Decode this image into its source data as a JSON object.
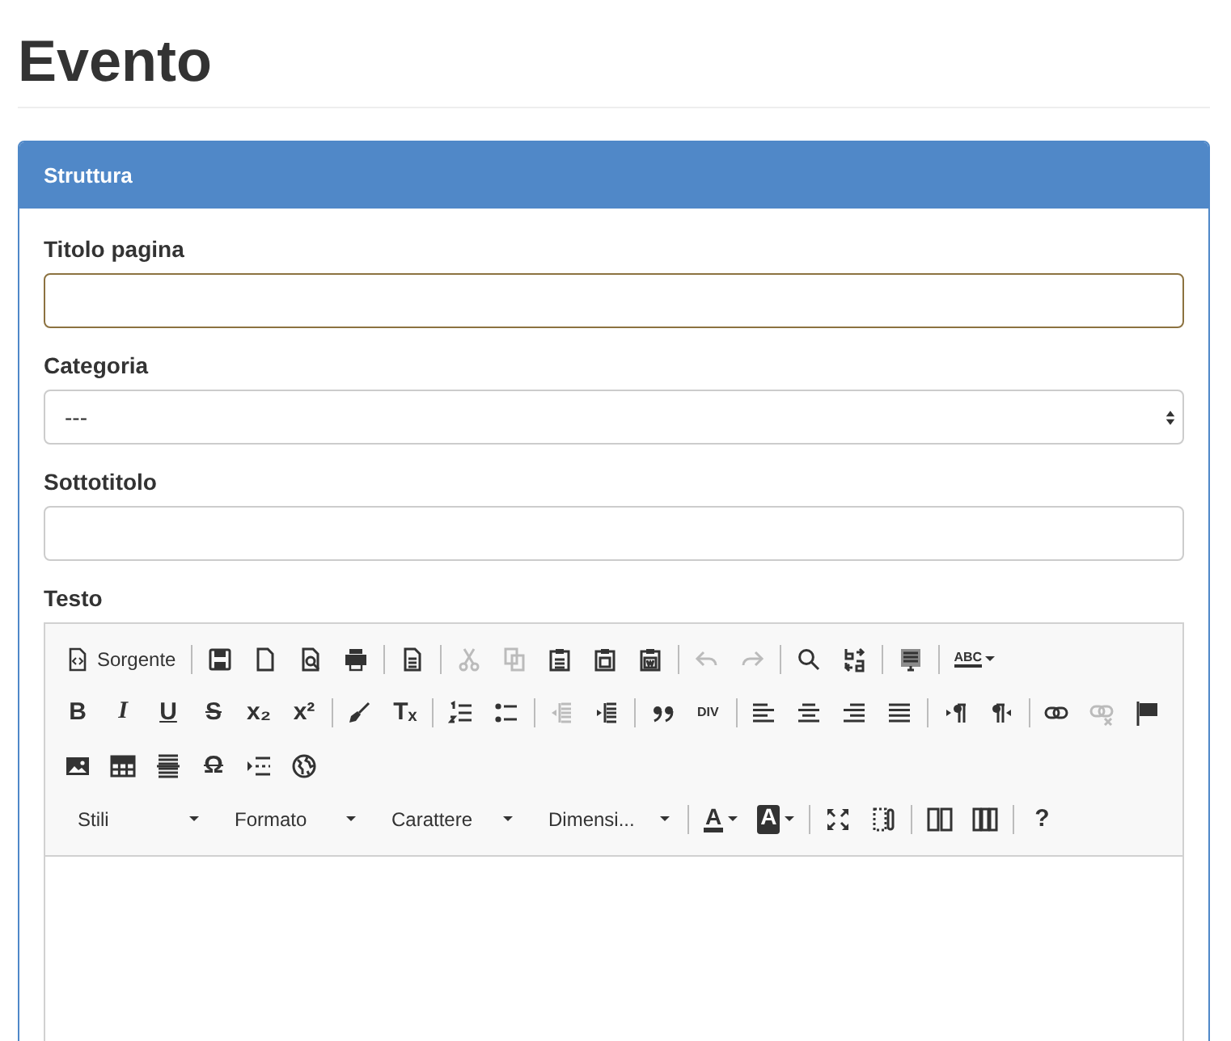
{
  "page_title": "Evento",
  "panel": {
    "title": "Struttura",
    "fields": [
      {
        "kind": "text",
        "label": "Titolo pagina",
        "focused": true
      },
      {
        "kind": "select",
        "label": "Categoria",
        "value": "---"
      },
      {
        "kind": "text",
        "label": "Sottotitolo",
        "focused": false
      },
      {
        "kind": "editor",
        "label": "Testo",
        "toolbar": [
          [
            [
              {
                "kind": "button",
                "label": "Sorgente"
              }
            ],
            [
              {
                "kind": "icon",
                "disabled": false
              },
              {
                "kind": "icon",
                "disabled": false
              },
              {
                "kind": "icon",
                "disabled": false
              },
              {
                "kind": "icon",
                "disabled": false
              }
            ],
            [
              {
                "kind": "icon",
                "disabled": false
              }
            ],
            [
              {
                "kind": "icon",
                "disabled": true
              },
              {
                "kind": "icon",
                "disabled": true
              },
              {
                "kind": "icon",
                "disabled": false
              },
              {
                "kind": "icon",
                "disabled": false
              },
              {
                "kind": "icon",
                "disabled": false
              }
            ],
            [
              {
                "kind": "icon",
                "disabled": true
              },
              {
                "kind": "icon",
                "disabled": true
              }
            ],
            [
              {
                "kind": "icon",
                "disabled": false
              },
              {
                "kind": "icon",
                "disabled": false
              }
            ],
            [
              {
                "kind": "icon",
                "disabled": false
              }
            ],
            [
              {
                "kind": "spell",
                "text": "ABC"
              }
            ]
          ],
          [
            [
              {
                "kind": "glyph",
                "text": "B"
              },
              {
                "kind": "glyph",
                "text": "I"
              },
              {
                "kind": "glyph",
                "text": "U"
              },
              {
                "kind": "glyph",
                "text": "S"
              },
              {
                "kind": "glyph",
                "text": "x₂"
              },
              {
                "kind": "glyph",
                "text": "x²"
              }
            ],
            [
              {
                "kind": "icon",
                "disabled": false
              },
              {
                "kind": "glyph",
                "text": "Tₓ"
              }
            ],
            [
              {
                "kind": "icon",
                "disabled": false
              },
              {
                "kind": "icon",
                "disabled": false
              }
            ],
            [
              {
                "kind": "icon",
                "disabled": true
              },
              {
                "kind": "icon",
                "disabled": false
              }
            ],
            [
              {
                "kind": "icon",
                "disabled": false
              },
              {
                "kind": "glyph",
                "text": "DIV"
              }
            ],
            [
              {
                "kind": "icon",
                "disabled": false
              },
              {
                "kind": "icon",
                "disabled": false
              },
              {
                "kind": "icon",
                "disabled": false
              },
              {
                "kind": "icon",
                "disabled": false
              }
            ],
            [
              {
                "kind": "icon",
                "disabled": false
              },
              {
                "kind": "icon",
                "disabled": false
              }
            ],
            [
              {
                "kind": "icon",
                "disabled": false
              },
              {
                "kind": "icon",
                "disabled": true
              },
              {
                "kind": "icon",
                "disabled": false
              }
            ]
          ],
          [
            [
              {
                "kind": "icon",
                "disabled": false
              },
              {
                "kind": "icon",
                "disabled": false
              },
              {
                "kind": "icon",
                "disabled": false
              },
              {
                "kind": "glyph",
                "text": "Ω"
              },
              {
                "kind": "icon",
                "disabled": false
              },
              {
                "kind": "icon",
                "disabled": false
              }
            ]
          ],
          [
            [
              {
                "kind": "combo",
                "label": "Stili"
              },
              {
                "kind": "combo",
                "label": "Formato"
              },
              {
                "kind": "combo",
                "label": "Carattere"
              },
              {
                "kind": "combo",
                "label": "Dimensi..."
              }
            ],
            [
              {
                "kind": "color",
                "text": "A",
                "filled": false
              },
              {
                "kind": "color",
                "text": "A",
                "filled": true
              }
            ],
            [
              {
                "kind": "icon",
                "disabled": false
              },
              {
                "kind": "icon",
                "disabled": false
              }
            ],
            [
              {
                "kind": "icon",
                "disabled": false
              },
              {
                "kind": "icon",
                "disabled": false
              }
            ],
            [
              {
                "kind": "glyph",
                "text": "?"
              }
            ]
          ]
        ]
      }
    ]
  }
}
